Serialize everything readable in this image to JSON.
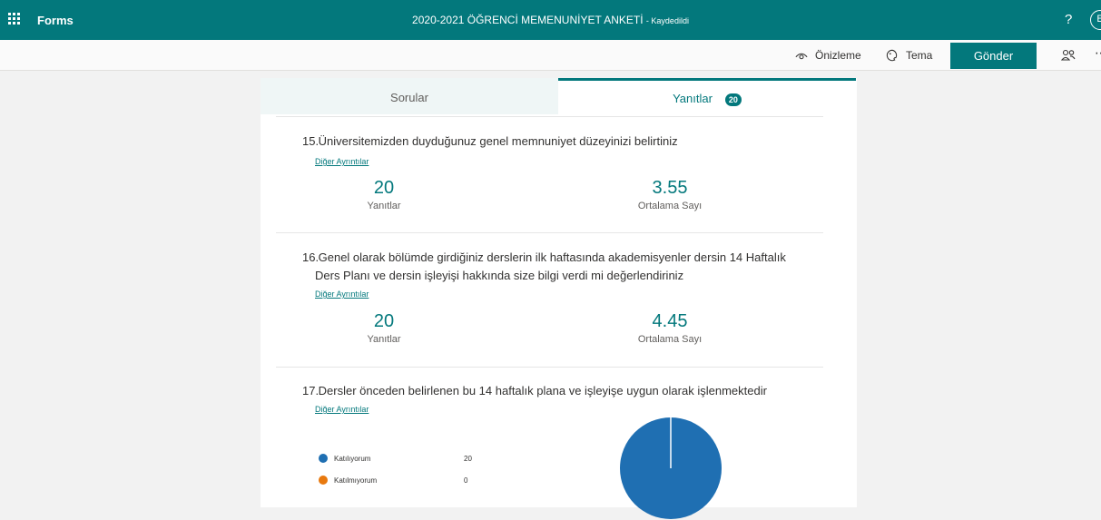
{
  "appbar": {
    "brand": "Forms",
    "title": "2020-2021 ÖĞRENCİ MEMENUNİYET ANKETİ",
    "saved": "Kaydedildi",
    "help": "?",
    "user_initial": "E"
  },
  "cmdbar": {
    "preview": "Önizleme",
    "theme": "Tema",
    "send": "Gönder"
  },
  "tabs": {
    "questions": "Sorular",
    "responses": "Yanıtlar",
    "response_count": "20"
  },
  "questions": [
    {
      "number": "15.",
      "title": "Üniversitemizden duyduğunuz genel memnuniyet düzeyinizi belirtiniz",
      "more": "Diğer Ayrıntılar",
      "responses_value": "20",
      "responses_label": "Yanıtlar",
      "average_value": "3.55",
      "average_label": "Ortalama Sayı"
    },
    {
      "number": "16.",
      "title_line1": "Genel olarak bölümde girdiğiniz derslerin ilk haftasında akademisyenler dersin 14 Haftalık",
      "title_line2": "Ders Planı ve dersin işleyişi hakkında size bilgi verdi mi değerlendiriniz",
      "more": "Diğer Ayrıntılar",
      "responses_value": "20",
      "responses_label": "Yanıtlar",
      "average_value": "4.45",
      "average_label": "Ortalama Sayı"
    },
    {
      "number": "17.",
      "title": "Dersler önceden belirlenen bu 14 haftalık plana ve işleyişe uygun olarak işlenmektedir",
      "more": "Diğer Ayrıntılar",
      "options": [
        {
          "label": "Katılıyorum",
          "count": "20",
          "color": "#1f6fb2"
        },
        {
          "label": "Katılmıyorum",
          "count": "0",
          "color": "#e8790e"
        }
      ]
    }
  ],
  "colors": {
    "accent": "#03787c",
    "pie_blue": "#1f6fb2",
    "pie_orange": "#e8790e"
  }
}
